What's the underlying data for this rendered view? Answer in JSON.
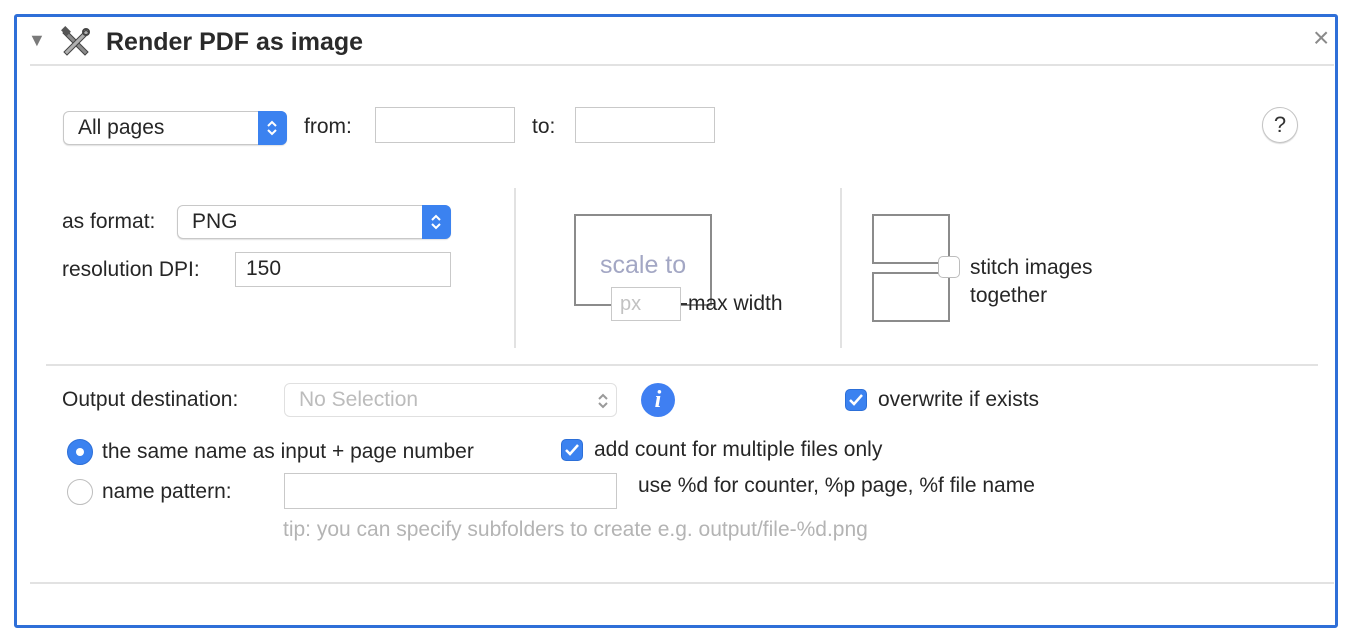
{
  "header": {
    "title": "Render PDF as image",
    "collapse_glyph": "▼",
    "close_glyph": "×",
    "icon": "automator-tools-icon"
  },
  "range": {
    "selected": "All pages",
    "from_label": "from:",
    "from_value": "",
    "to_label": "to:",
    "to_value": "",
    "help_glyph": "?"
  },
  "format": {
    "format_label": "as format:",
    "format_value": "PNG",
    "dpi_label": "resolution DPI:",
    "dpi_value": "150"
  },
  "scale": {
    "scale_text": "scale to",
    "px_placeholder": "px",
    "max_width_label": "max width"
  },
  "stitch": {
    "label_line1": "stitch images",
    "label_line2": "together",
    "checked": false
  },
  "output": {
    "destination_label": "Output destination:",
    "destination_value": "No Selection",
    "info_glyph": "i",
    "overwrite_label": "overwrite if exists",
    "overwrite_checked": true,
    "same_name_label": "the same name as input + page number",
    "add_count_label": "add count for multiple files only",
    "add_count_checked": true,
    "name_pattern_label": "name pattern:",
    "name_pattern_value": "",
    "pattern_hint": "use %d for counter, %p page, %f file name",
    "tip": "tip: you can specify subfolders to create e.g. output/file-%d.png",
    "selected_radio": "same-name"
  },
  "colors": {
    "accent": "#3b82f0",
    "frame_border": "#2f6fd8",
    "muted_text": "#b4b4b4"
  }
}
